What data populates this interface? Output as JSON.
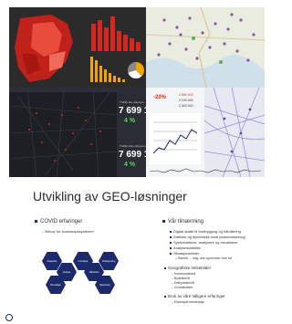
{
  "tracking_panel": {
    "kpis": [
      {
        "title": "Trafikk alle dagnene",
        "value": "7 699 118",
        "change": "4 %"
      },
      {
        "title": "Trafikk siste dagnene",
        "value": "7 699 118",
        "change": "4 %"
      }
    ]
  },
  "analytics_panel": {
    "badge": "-20%",
    "value1": "2 550 000",
    "value2": "2 190 000",
    "value3": "2 300 000"
  },
  "slide": {
    "title": "Utvikling av GEO-løsninger",
    "left": {
      "heading": "COVID erfaringer",
      "sub": "Behov for kunnskapssystemer",
      "hexes": [
        "Nasjonale",
        "Kunnskap",
        "Smittesporing",
        "Analyse",
        "Sårbarhet",
        "Beredskap",
        "Beslutning"
      ]
    },
    "right": {
      "heading": "Vår tilnærming",
      "bullets": [
        "Digital støtte til forebygging og håndtering",
        "Statiske og dynamiske data (automatisering)",
        "Systematisere, analysere og visualisere",
        "Analysestatistikk",
        "Situasjonsbilder"
      ],
      "sub1": "Samtid → dag, uke og trender over tid",
      "heading2": "Geografiske helsebilder",
      "geo": [
        "Kommunalnivå",
        "Bydelsnivå",
        "Delbydelsnivå",
        "Grunnkretser"
      ],
      "heading3": "Bruk av våre tidligere erfaringer",
      "sub2": "Eksempel beredskap"
    }
  },
  "colors": {
    "accent": "#1c2a6b",
    "red": "#d7261e",
    "kpi_green": "#5cd65c"
  }
}
